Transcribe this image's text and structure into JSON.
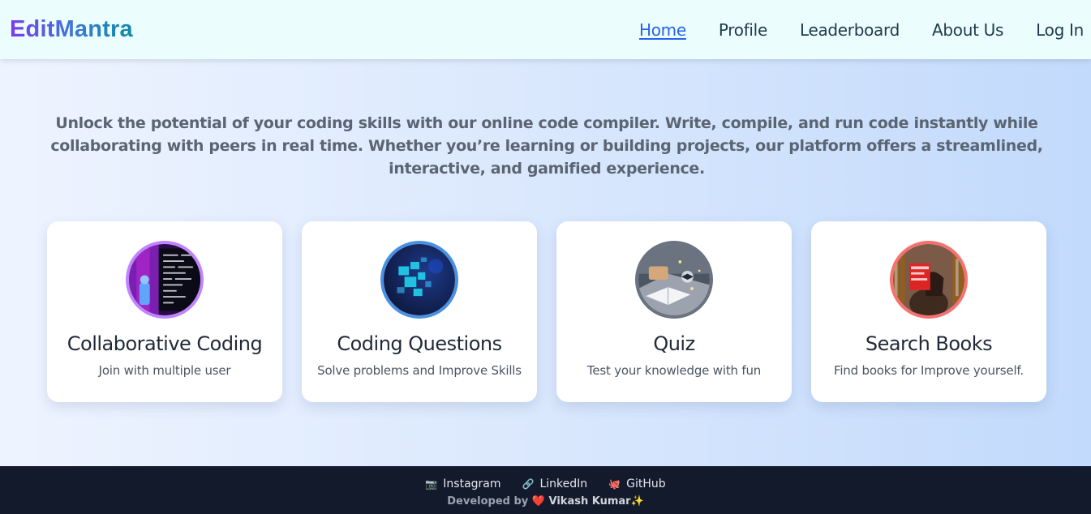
{
  "brand": {
    "name": "EditMantra"
  },
  "nav": {
    "links": [
      {
        "label": "Home",
        "active": true
      },
      {
        "label": "Profile",
        "active": false
      },
      {
        "label": "Leaderboard",
        "active": false
      },
      {
        "label": "About Us",
        "active": false
      },
      {
        "label": "Log In",
        "active": false
      }
    ]
  },
  "intro": {
    "text": "Unlock the potential of your coding skills with our online code compiler. Write, compile, and run code instantly while collaborating with peers in real time. Whether you’re learning or building projects, our platform offers a streamlined, interactive, and gamified experience."
  },
  "cards": [
    {
      "title": "Collaborative Coding",
      "description": "Join with multiple user",
      "border_color": "#c084fc",
      "image": "code-screen-image"
    },
    {
      "title": "Coding Questions",
      "description": "Solve problems and Improve Skills",
      "border_color": "#4a90e2",
      "image": "digital-blocks-image"
    },
    {
      "title": "Quiz",
      "description": "Test your knowledge with fun",
      "border_color": "#6b7280",
      "image": "study-laptop-image"
    },
    {
      "title": "Search Books",
      "description": "Find books for Improve yourself.",
      "border_color": "#f87171",
      "image": "reading-book-image"
    }
  ],
  "footer": {
    "links": [
      {
        "label": "Instagram",
        "icon": "camera-icon",
        "glyph": "📷"
      },
      {
        "label": "LinkedIn",
        "icon": "link-icon",
        "glyph": "🔗"
      },
      {
        "label": "GitHub",
        "icon": "octopus-icon",
        "glyph": "🐙"
      }
    ],
    "credit_prefix": "Developed by",
    "heart": "❤️",
    "author": "Vikash Kumar",
    "sparkle": "✨"
  },
  "colors": {
    "nav_bg": "#ecfdfe",
    "active_link": "#2563eb",
    "footer_bg": "#121a2b"
  }
}
